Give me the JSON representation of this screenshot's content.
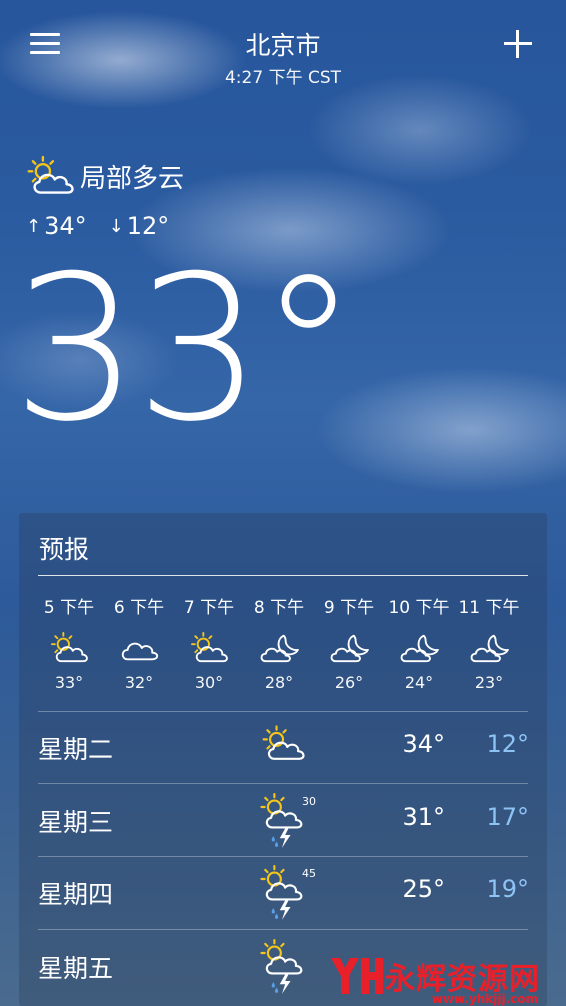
{
  "header": {
    "city": "北京市",
    "time": "4:27 下午 CST"
  },
  "current": {
    "condition": "局部多云",
    "condition_icon": "partly-cloudy-icon",
    "high": "34°",
    "low": "12°",
    "temperature": "33°"
  },
  "forecast": {
    "title": "预报",
    "hourly": [
      {
        "time": "5 下午",
        "icon": "partly-cloudy-icon",
        "temp": "33°"
      },
      {
        "time": "6 下午",
        "icon": "cloudy-icon",
        "temp": "32°"
      },
      {
        "time": "7 下午",
        "icon": "partly-cloudy-icon",
        "temp": "30°"
      },
      {
        "time": "8 下午",
        "icon": "night-cloudy-icon",
        "temp": "28°"
      },
      {
        "time": "9 下午",
        "icon": "night-cloudy-icon",
        "temp": "26°"
      },
      {
        "time": "10 下午",
        "icon": "night-cloudy-icon",
        "temp": "24°"
      },
      {
        "time": "11 下午",
        "icon": "night-cloudy-icon",
        "temp": "23°"
      }
    ],
    "daily": [
      {
        "day": "星期二",
        "icon": "partly-cloudy-icon",
        "pop": "",
        "high": "34°",
        "low": "12°"
      },
      {
        "day": "星期三",
        "icon": "thunderstorm-icon",
        "pop": "30",
        "high": "31°",
        "low": "17°"
      },
      {
        "day": "星期四",
        "icon": "thunderstorm-icon",
        "pop": "45",
        "high": "25°",
        "low": "19°"
      },
      {
        "day": "星期五",
        "icon": "thunderstorm-icon",
        "pop": "",
        "high": "",
        "low": ""
      }
    ]
  },
  "watermark": {
    "text": "永辉资源网",
    "url": "www.yhkjjj.com"
  },
  "colors": {
    "low_temp": "#8ec3f5",
    "watermark": "#e8202a"
  }
}
